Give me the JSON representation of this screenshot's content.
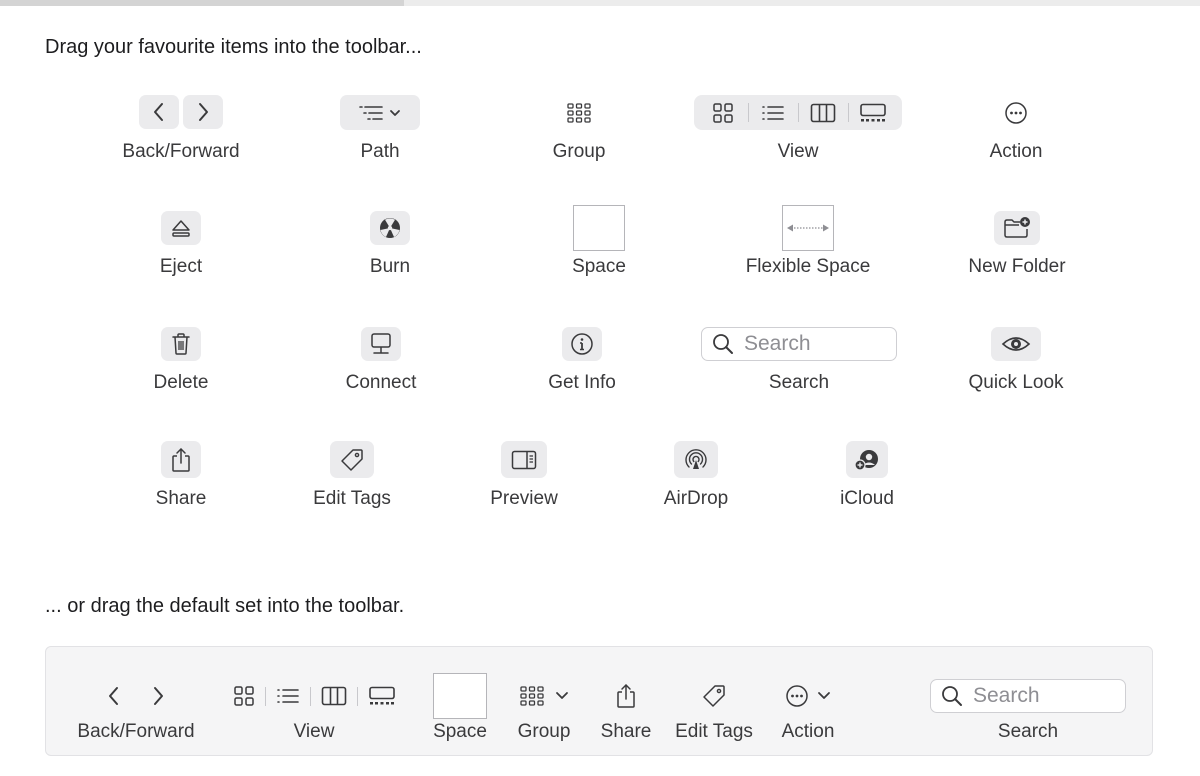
{
  "palette": {
    "background": "#ffffff",
    "button_bg": "#ebebed",
    "icon_color": "#3a3a3c",
    "label_color": "#3a3a3c",
    "default_bar_bg": "#f5f5f6"
  },
  "header": {
    "title": "Drag your favourite items into the toolbar..."
  },
  "items": {
    "back_forward": {
      "label": "Back/Forward",
      "icons": [
        "chevron-left-icon",
        "chevron-right-icon"
      ]
    },
    "path": {
      "label": "Path",
      "icon": "path-list-icon"
    },
    "group": {
      "label": "Group",
      "icon": "group-grid-icon"
    },
    "view": {
      "label": "View",
      "icons": [
        "icon-view-icon",
        "list-view-icon",
        "column-view-icon",
        "gallery-view-icon"
      ]
    },
    "action": {
      "label": "Action",
      "icon": "ellipsis-circle-icon"
    },
    "eject": {
      "label": "Eject",
      "icon": "eject-icon"
    },
    "burn": {
      "label": "Burn",
      "icon": "burn-icon"
    },
    "space": {
      "label": "Space"
    },
    "flexible_space": {
      "label": "Flexible Space",
      "icon": "double-arrow-icon"
    },
    "new_folder": {
      "label": "New Folder",
      "icon": "new-folder-icon"
    },
    "delete": {
      "label": "Delete",
      "icon": "trash-icon"
    },
    "connect": {
      "label": "Connect",
      "icon": "connect-icon"
    },
    "get_info": {
      "label": "Get Info",
      "icon": "info-icon"
    },
    "search": {
      "label": "Search",
      "placeholder": "Search",
      "icon": "search-icon"
    },
    "quick_look": {
      "label": "Quick Look",
      "icon": "eye-icon"
    },
    "share": {
      "label": "Share",
      "icon": "share-icon"
    },
    "edit_tags": {
      "label": "Edit Tags",
      "icon": "tag-icon"
    },
    "preview": {
      "label": "Preview",
      "icon": "preview-pane-icon"
    },
    "airdrop": {
      "label": "AirDrop",
      "icon": "airdrop-icon"
    },
    "icloud": {
      "label": "iCloud",
      "icon": "icloud-icon"
    }
  },
  "default_set": {
    "title": "... or drag the default set into the toolbar.",
    "items": {
      "back_forward": "Back/Forward",
      "view": "View",
      "space": "Space",
      "group": "Group",
      "share": "Share",
      "edit_tags": "Edit Tags",
      "action": "Action",
      "search_label": "Search",
      "search_placeholder": "Search"
    }
  }
}
